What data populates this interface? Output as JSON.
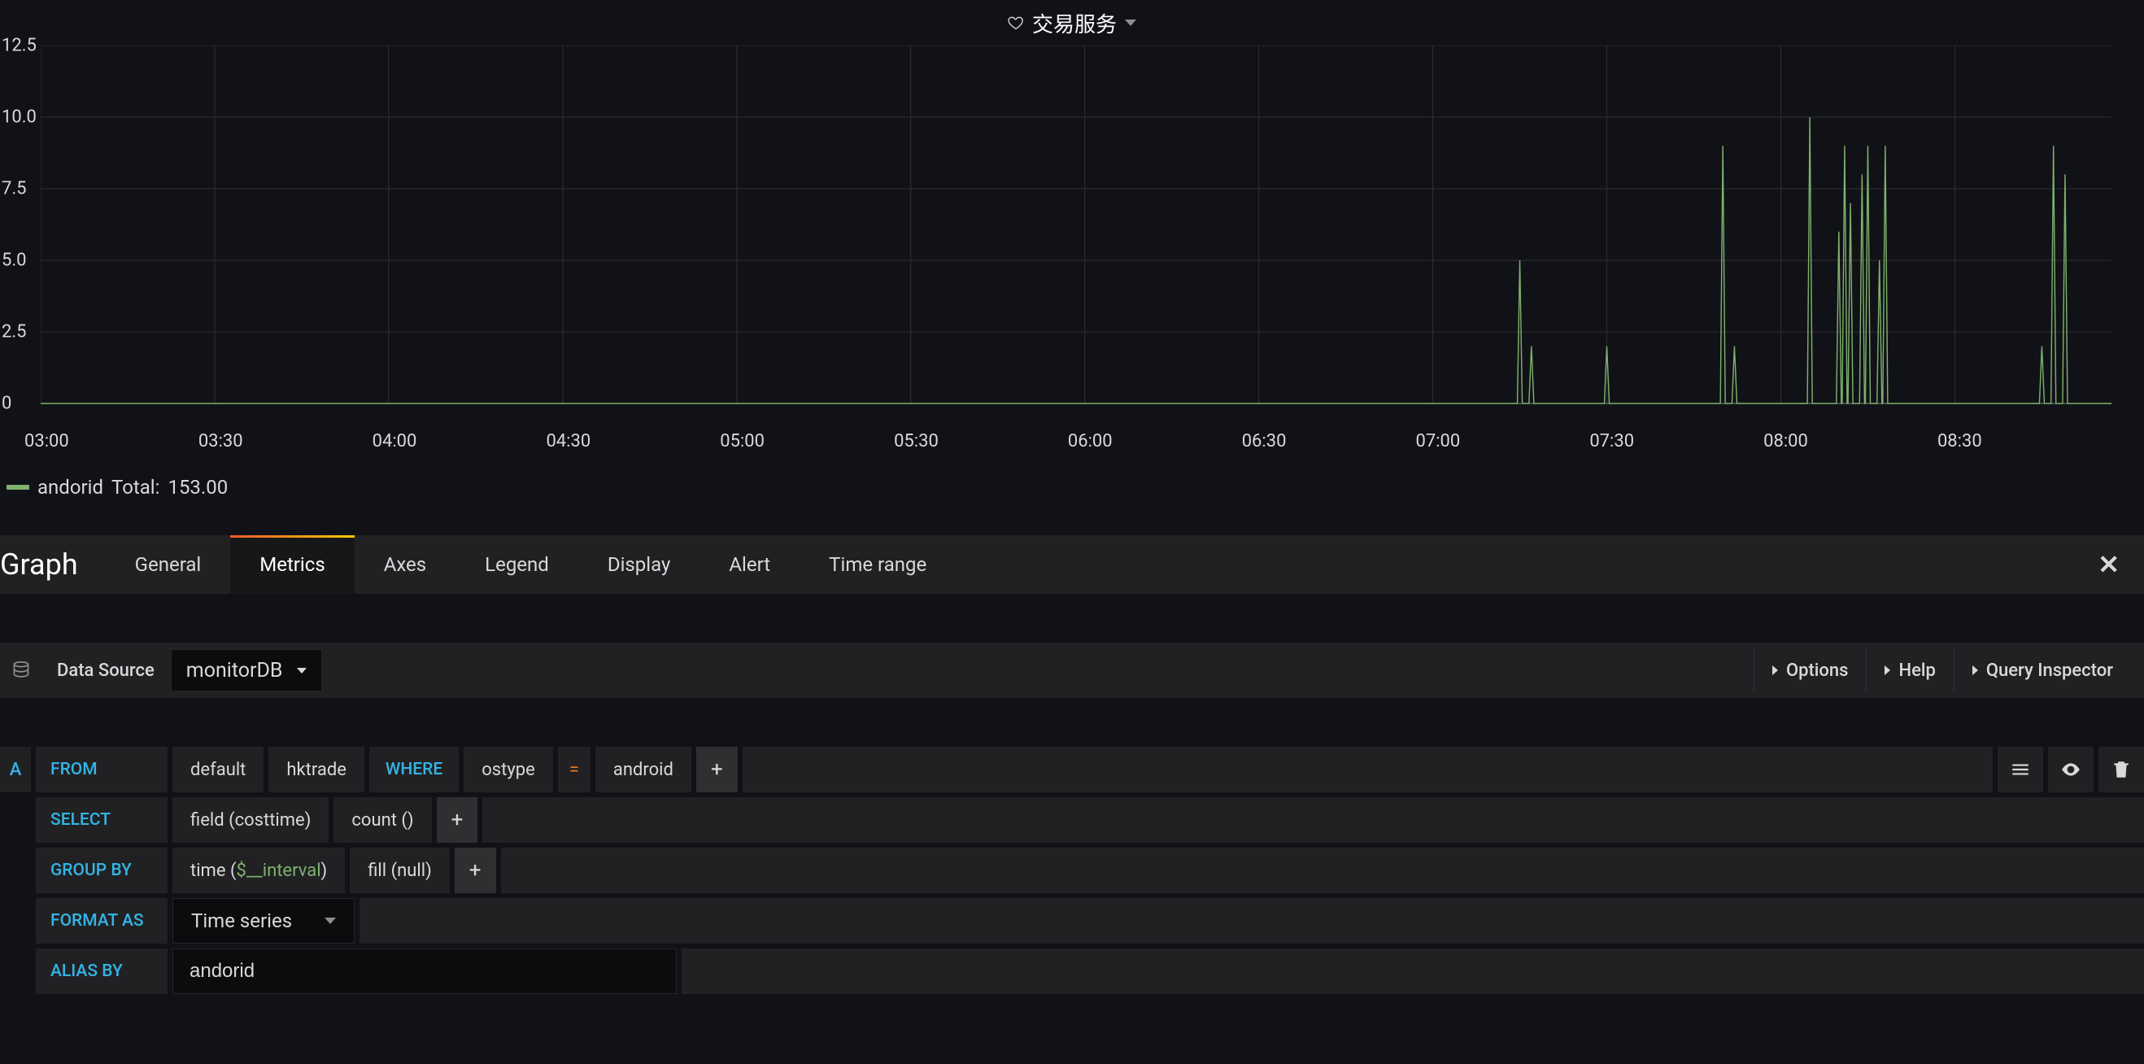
{
  "panel": {
    "title": "交易服务"
  },
  "chart_data": {
    "type": "line",
    "title": "交易服务",
    "xlabel": "",
    "ylabel": "",
    "ylim": [
      0,
      12.5
    ],
    "xlim": [
      "03:00",
      "08:57"
    ],
    "y_ticks": [
      0,
      2.5,
      5.0,
      7.5,
      10.0,
      12.5
    ],
    "x_ticks": [
      "03:00",
      "03:30",
      "04:00",
      "04:30",
      "05:00",
      "05:30",
      "06:00",
      "06:30",
      "07:00",
      "07:30",
      "08:00",
      "08:30"
    ],
    "series": [
      {
        "name": "andorid",
        "total": 153.0,
        "points": [
          {
            "t": "07:15",
            "v": 5
          },
          {
            "t": "07:17",
            "v": 2
          },
          {
            "t": "07:30",
            "v": 2
          },
          {
            "t": "07:50",
            "v": 9
          },
          {
            "t": "07:52",
            "v": 2
          },
          {
            "t": "08:05",
            "v": 10
          },
          {
            "t": "08:10",
            "v": 6
          },
          {
            "t": "08:11",
            "v": 9
          },
          {
            "t": "08:12",
            "v": 7
          },
          {
            "t": "08:14",
            "v": 8
          },
          {
            "t": "08:15",
            "v": 9
          },
          {
            "t": "08:17",
            "v": 5
          },
          {
            "t": "08:18",
            "v": 9
          },
          {
            "t": "08:45",
            "v": 2
          },
          {
            "t": "08:47",
            "v": 9
          },
          {
            "t": "08:49",
            "v": 8
          }
        ]
      }
    ]
  },
  "legend": {
    "name": "andorid",
    "total_label": "Total:",
    "total_value": "153.00"
  },
  "editor": {
    "type_label": "Graph",
    "tabs": [
      "General",
      "Metrics",
      "Axes",
      "Legend",
      "Display",
      "Alert",
      "Time range"
    ],
    "active_tab": "Metrics"
  },
  "datasource": {
    "label": "Data Source",
    "selected": "monitorDB",
    "actions": {
      "options": "Options",
      "help": "Help",
      "inspector": "Query Inspector"
    }
  },
  "query": {
    "id": "A",
    "from": {
      "label": "FROM",
      "policy": "default",
      "measurement": "hktrade",
      "where_label": "WHERE",
      "tag_key": "ostype",
      "operator": "=",
      "tag_value": "android"
    },
    "select": {
      "label": "SELECT",
      "field": "field (costtime)",
      "agg": "count ()"
    },
    "group_by": {
      "label": "GROUP BY",
      "time_prefix": "time (",
      "time_var": "$__interval",
      "time_suffix": ")",
      "fill": "fill (null)"
    },
    "format_as": {
      "label": "FORMAT AS",
      "value": "Time series"
    },
    "alias_by": {
      "label": "ALIAS BY",
      "value": "andorid"
    }
  }
}
